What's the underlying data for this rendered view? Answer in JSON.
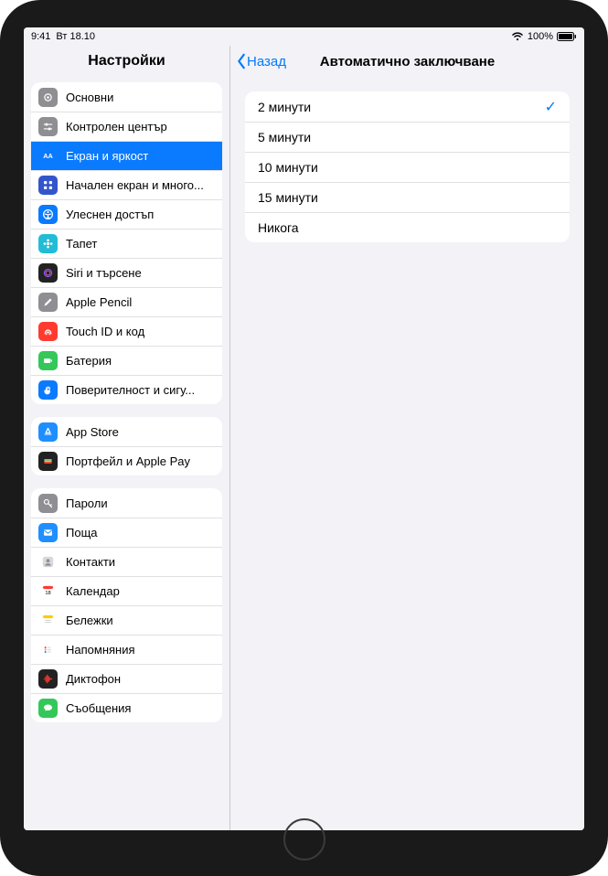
{
  "status": {
    "time": "9:41",
    "date": "Вт 18.10",
    "battery": "100%"
  },
  "sidebar": {
    "title": "Настройки",
    "groups": [
      {
        "items": [
          {
            "id": "general",
            "label": "Основни",
            "icon": "gear",
            "bg": "#8e8e93"
          },
          {
            "id": "control",
            "label": "Контролен център",
            "icon": "sliders",
            "bg": "#8e8e93"
          },
          {
            "id": "display",
            "label": "Екран и яркост",
            "icon": "brightness",
            "bg": "#0a7aff",
            "selected": true
          },
          {
            "id": "homescreen",
            "label": "Начален екран и много...",
            "icon": "grid",
            "bg": "#3355cc"
          },
          {
            "id": "access",
            "label": "Улеснен достъп",
            "icon": "access",
            "bg": "#0a7aff"
          },
          {
            "id": "wallpaper",
            "label": "Тапет",
            "icon": "flower",
            "bg": "#22bcd6"
          },
          {
            "id": "siri",
            "label": "Siri и търсене",
            "icon": "siri",
            "bg": "#222222"
          },
          {
            "id": "pencil",
            "label": "Apple Pencil",
            "icon": "pencil",
            "bg": "#8e8e93"
          },
          {
            "id": "touchid",
            "label": "Touch ID и код",
            "icon": "finger",
            "bg": "#ff3b30"
          },
          {
            "id": "battery",
            "label": "Батерия",
            "icon": "battery",
            "bg": "#34c759"
          },
          {
            "id": "privacy",
            "label": "Поверителност и сигу...",
            "icon": "hand",
            "bg": "#0a7aff"
          }
        ]
      },
      {
        "items": [
          {
            "id": "appstore",
            "label": "App Store",
            "icon": "appstore",
            "bg": "#1f8fff"
          },
          {
            "id": "wallet",
            "label": "Портфейл и Apple Pay",
            "icon": "wallet",
            "bg": "#222222"
          }
        ]
      },
      {
        "items": [
          {
            "id": "passwords",
            "label": "Пароли",
            "icon": "key",
            "bg": "#8e8e93"
          },
          {
            "id": "mail",
            "label": "Поща",
            "icon": "mail",
            "bg": "#1f8fff"
          },
          {
            "id": "contacts",
            "label": "Контакти",
            "icon": "contact",
            "bg": "#ffffff"
          },
          {
            "id": "calendar",
            "label": "Календар",
            "icon": "calendar",
            "bg": "#ffffff"
          },
          {
            "id": "notes",
            "label": "Бележки",
            "icon": "notes",
            "bg": "#ffffff"
          },
          {
            "id": "reminders",
            "label": "Напомняния",
            "icon": "reminders",
            "bg": "#ffffff"
          },
          {
            "id": "voicememos",
            "label": "Диктофон",
            "icon": "voice",
            "bg": "#222222"
          },
          {
            "id": "messages",
            "label": "Съобщения",
            "icon": "message",
            "bg": "#34c759"
          }
        ]
      }
    ]
  },
  "detail": {
    "back": "Назад",
    "title": "Автоматично заключване",
    "selected": 0,
    "options": [
      "2 минути",
      "5 минути",
      "10 минути",
      "15 минути",
      "Никога"
    ]
  }
}
